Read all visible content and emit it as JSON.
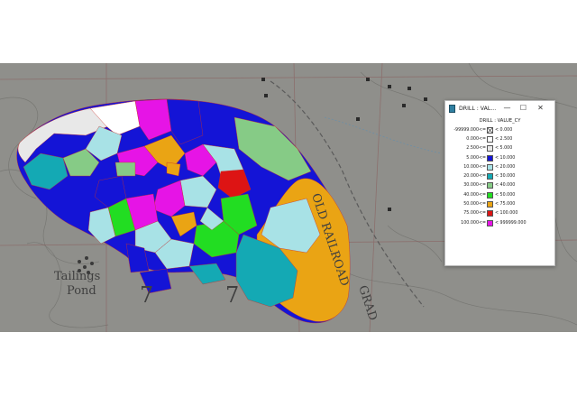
{
  "window": {
    "title": "DRILL : VAL...",
    "buttons": {
      "minimize": "—",
      "maximize": "☐",
      "close": "✕"
    }
  },
  "legend": {
    "heading": "DRILL : VALUE_CY",
    "rows": [
      {
        "from": "-99999.000",
        "op": "<=",
        "to": "< 0.000",
        "color": "#ffffff",
        "crossed": true
      },
      {
        "from": "0.000",
        "op": "<=",
        "to": "< 2.500",
        "color": "#ffffff",
        "crossed": false
      },
      {
        "from": "2.500",
        "op": "<=",
        "to": "< 5.000",
        "color": "#e8e8e8",
        "crossed": false
      },
      {
        "from": "5.000",
        "op": "<=",
        "to": "< 10.000",
        "color": "#1414d6",
        "crossed": false
      },
      {
        "from": "10.000",
        "op": "<=",
        "to": "< 20.000",
        "color": "#a8e2e6",
        "crossed": false
      },
      {
        "from": "20.000",
        "op": "<=",
        "to": "< 30.000",
        "color": "#14a9b4",
        "crossed": false
      },
      {
        "from": "30.000",
        "op": "<=",
        "to": "< 40.000",
        "color": "#86cb86",
        "crossed": false
      },
      {
        "from": "40.000",
        "op": "<=",
        "to": "< 50.000",
        "color": "#22dd22",
        "crossed": false
      },
      {
        "from": "50.000",
        "op": "<=",
        "to": "< 75.000",
        "color": "#eaa414",
        "crossed": false
      },
      {
        "from": "75.000",
        "op": "<=",
        "to": "< 100.000",
        "color": "#dd1414",
        "crossed": false
      },
      {
        "from": "100.000",
        "op": "<=",
        "to": "< 999999.000",
        "color": "#e614e6",
        "crossed": false
      }
    ]
  },
  "map": {
    "labels": {
      "road": "OLD RAILROAD",
      "road_continuation": "GRAD",
      "pond_line1": "Tailings",
      "pond_line2": "Pond",
      "section_a": "7",
      "section_b": "7"
    }
  }
}
